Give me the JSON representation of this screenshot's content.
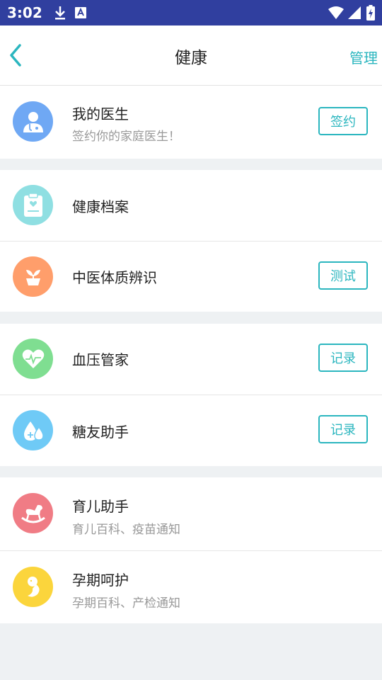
{
  "status_bar": {
    "time": "3:02"
  },
  "header": {
    "title": "健康",
    "manage_label": "管理"
  },
  "sections": {
    "doctor": {
      "title": "我的医生",
      "subtitle": "签约你的家庭医生！",
      "button": "签约"
    },
    "records": {
      "title": "健康档案"
    },
    "tcm": {
      "title": "中医体质辨识",
      "button": "测试"
    },
    "bp": {
      "title": "血压管家",
      "button": "记录"
    },
    "diabetes": {
      "title": "糖友助手",
      "button": "记录"
    },
    "parenting": {
      "title": "育儿助手",
      "subtitle": "育儿百科、疫苗通知"
    },
    "pregnancy": {
      "title": "孕期呵护",
      "subtitle": "孕期百科、产检通知"
    }
  },
  "colors": {
    "accent": "#2bb6bf",
    "status_bar": "#303f9f",
    "doctor_icon": "#6fa8f4",
    "records_icon": "#8fdfe2",
    "tcm_icon": "#ff9e6b",
    "bp_icon": "#7fde91",
    "diabetes_icon": "#6fcaf6",
    "parenting_icon": "#f07c85",
    "pregnancy_icon": "#fbd53c"
  }
}
